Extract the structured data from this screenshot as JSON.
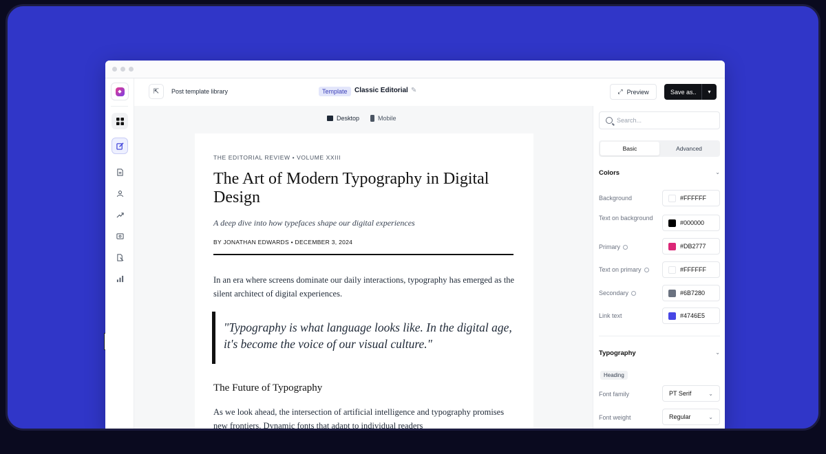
{
  "topbar": {
    "crumb": "Post template library",
    "template_badge": "Template",
    "template_name": "Classic Editorial",
    "preview_label": "Preview",
    "save_label": "Save as.."
  },
  "canvas": {
    "devices": [
      "Desktop",
      "Mobile"
    ]
  },
  "article": {
    "kicker": "THE EDITORIAL REVIEW • VOLUME XXIII",
    "headline": "The Art of Modern Typography in Digital Design",
    "dek": "A deep dive into how typefaces shape our digital experiences",
    "byline": "BY JONATHAN EDWARDS • DECEMBER 3, 2024",
    "para1": "In an era where screens dominate our daily interactions, typography has emerged as the silent architect of digital experiences.",
    "quote": "\"Typography is what language looks like. In the digital age, it's become the voice of our visual culture.\"",
    "subheading": "The Future of Typography",
    "para2": "As we look ahead, the intersection of artificial intelligence and typography promises new frontiers. Dynamic fonts that adapt to individual readers"
  },
  "panel": {
    "search_placeholder": "Search...",
    "tabs": [
      "Basic",
      "Advanced"
    ],
    "colors_title": "Colors",
    "colors": [
      {
        "label": "Background",
        "value": "#FFFFFF"
      },
      {
        "label": "Text on background",
        "value": "#000000"
      },
      {
        "label": "Primary",
        "value": "#DB2777"
      },
      {
        "label": "Text on primary",
        "value": "#FFFFFF"
      },
      {
        "label": "Secondary",
        "value": "#6B7280"
      },
      {
        "label": "Link text",
        "value": "#4746E5"
      }
    ],
    "typography_title": "Typography",
    "typography_chip": "Heading",
    "font_family_label": "Font family",
    "font_family_value": "PT Serif",
    "font_weight_label": "Font weight",
    "font_weight_value": "Regular"
  },
  "theme": {
    "stage_bg": "#3036C8",
    "accent": "#3B3FD8"
  },
  "icons": {
    "rail": [
      "grid-icon",
      "edit-icon",
      "document-icon",
      "users-icon",
      "trend-icon",
      "image-icon",
      "files-icon",
      "chart-icon"
    ]
  }
}
